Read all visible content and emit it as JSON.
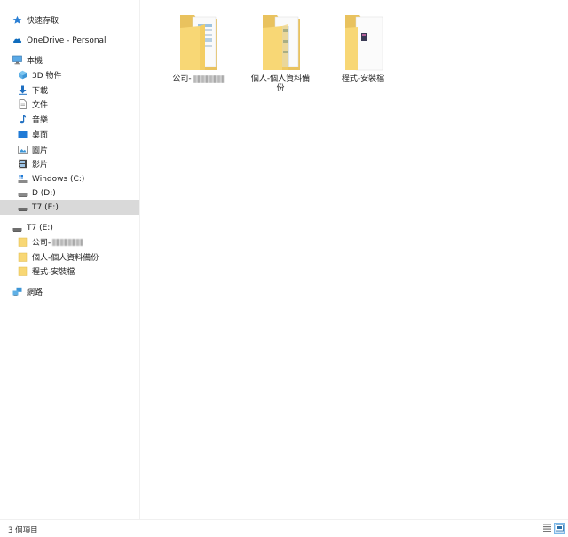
{
  "nav": {
    "quick_access": "快速存取",
    "onedrive": "OneDrive - Personal",
    "this_pc": "本機",
    "items": [
      {
        "label": "3D 物件"
      },
      {
        "label": "下載"
      },
      {
        "label": "文件"
      },
      {
        "label": "音樂"
      },
      {
        "label": "桌面"
      },
      {
        "label": "圖片"
      },
      {
        "label": "影片"
      },
      {
        "label": "Windows (C:)"
      },
      {
        "label": "D (D:)"
      },
      {
        "label": "T7 (E:)"
      }
    ],
    "drive": "T7 (E:)",
    "drive_children": [
      {
        "label": "公司-"
      },
      {
        "label": "個人-個人資料備份"
      },
      {
        "label": "程式-安裝檔"
      }
    ],
    "network": "網路"
  },
  "folders": [
    {
      "name": "公司-"
    },
    {
      "name": "個人-個人資料備份"
    },
    {
      "name": "程式-安裝檔"
    }
  ],
  "status": {
    "item_count": "3 個項目"
  },
  "colors": {
    "selected_bg": "#d9d9d9",
    "folder_yellow": "#f8d775",
    "accent_blue": "#0078d7"
  }
}
